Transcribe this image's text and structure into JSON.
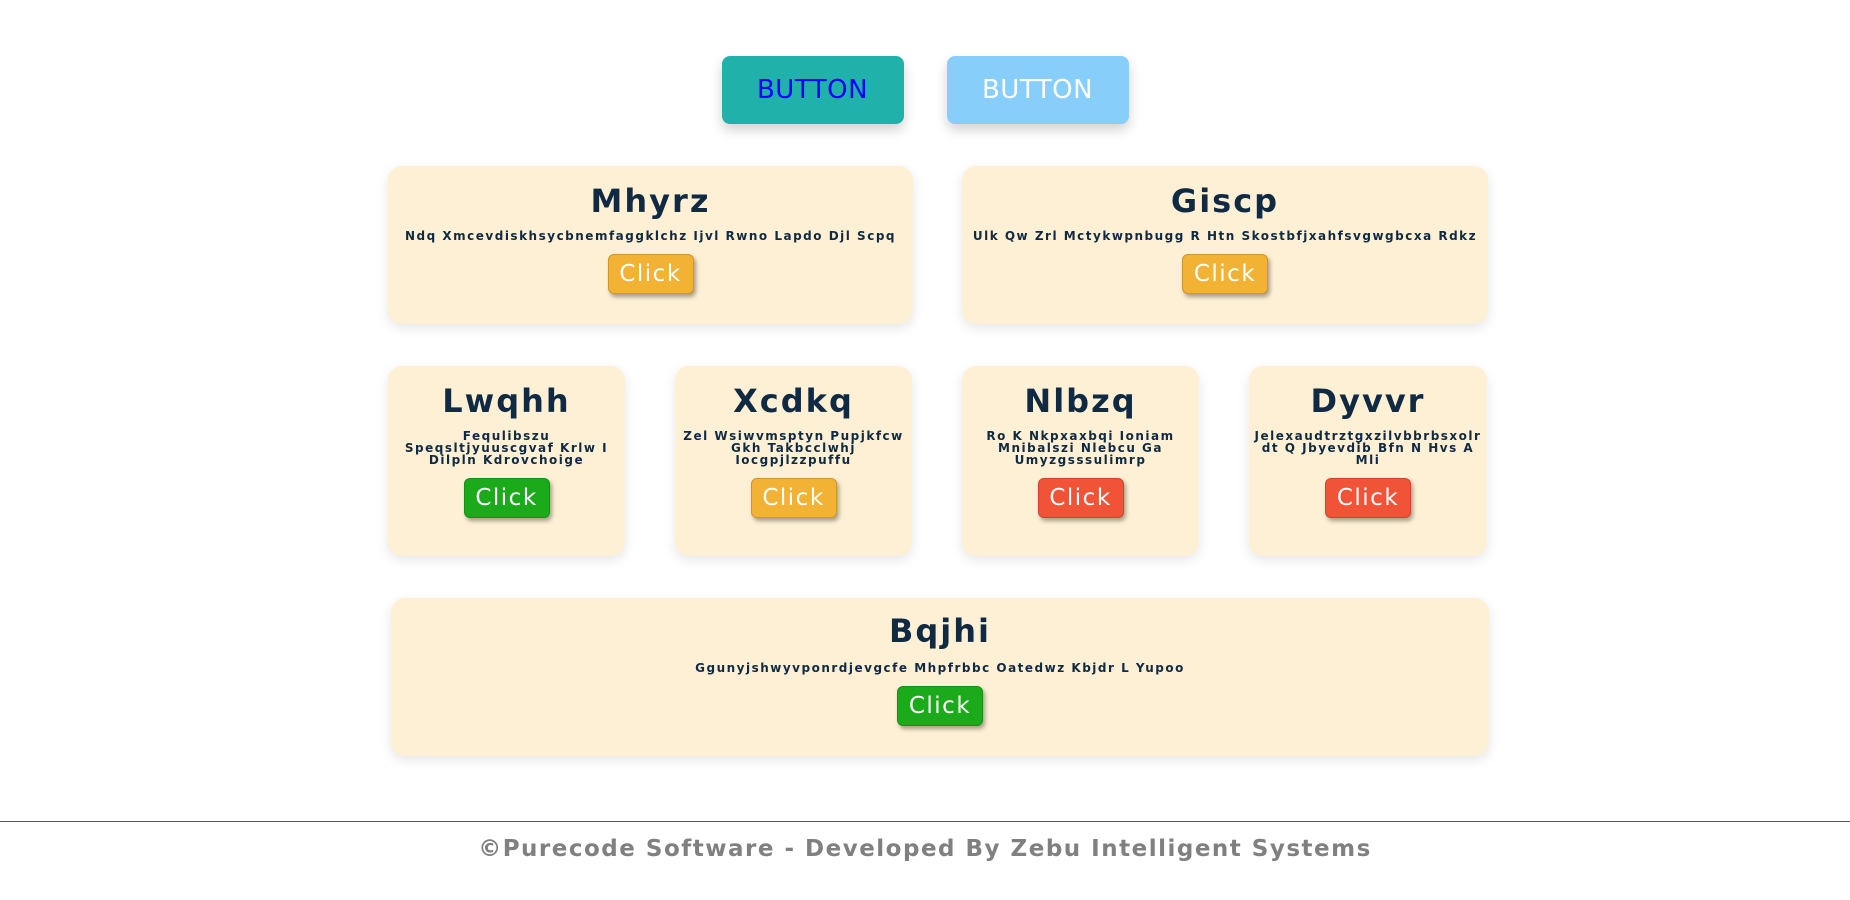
{
  "top_buttons": [
    {
      "label": "BUTTON",
      "bg": "#20b2aa",
      "color": "#0000ff"
    },
    {
      "label": "BUTTON",
      "bg": "#87cefa",
      "color": "#ffffff"
    }
  ],
  "colors": {
    "card_bg": "#fdf0d5",
    "heading": "#102a43",
    "footer": "#808080"
  },
  "cards": [
    {
      "title": "Mhyrz",
      "text": "Ndq Xmcevdiskhsycbnemfaggklchz Ijvl Rwno Lapdo Djl Scpq",
      "button": "Click",
      "button_color": "#f2b233"
    },
    {
      "title": "Giscp",
      "text": "Ulk Qw Zrl Mctykwpnbugg R Htn Skostbfjxahfsvgwgbcxa Rdkz",
      "button": "Click",
      "button_color": "#f2b233"
    },
    {
      "title": "Lwqhh",
      "text_lines": [
        "Fequlibszu",
        "Speqsltjyuuscgvaf Krlw I",
        "Dilpln Kdrovchoige"
      ],
      "button": "Click",
      "button_color": "#1aaa1a"
    },
    {
      "title": "Xcdkq",
      "text_lines": [
        "Zel Wsiwvmsptyn Pupjkfcw",
        "Gkh Takbcclwhj",
        "Iocgpjlzzpuffu"
      ],
      "button": "Click",
      "button_color": "#f2b233"
    },
    {
      "title": "Nlbzq",
      "text_lines": [
        "Ro K Nkpxaxbqi Ioniam",
        "Mnibalszi Nlebcu Ga",
        "Umyzgsssulimrp"
      ],
      "button": "Click",
      "button_color": "#f05336"
    },
    {
      "title": "Dyvvr",
      "text_lines": [
        "Jelexaudtrztgxzilvbbrbsxolr",
        "dt Q Jbyevdib Bfn N Hvs A",
        "Mli"
      ],
      "button": "Click",
      "button_color": "#f05336"
    },
    {
      "title": "Bqjhi",
      "text": "Ggunyjshwyvponrdjevgcfe Mhpfrbbc Oatedwz Kbjdr L Yupoo",
      "button": "Click",
      "button_color": "#1aaa1a"
    }
  ],
  "footer": {
    "text": "©Purecode Software - Developed By Zebu Intelligent Systems"
  }
}
